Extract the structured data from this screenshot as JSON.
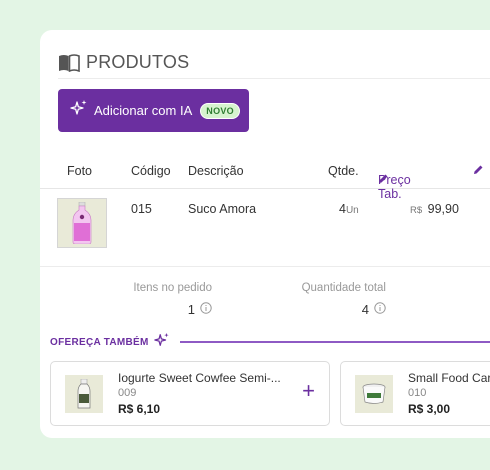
{
  "section": {
    "title": "PRODUTOS",
    "icon": "book-open-icon"
  },
  "ai_button": {
    "label": "Adicionar com IA",
    "badge": "NOVO",
    "icon": "sparkles-icon",
    "color": "#6b2fa0"
  },
  "table": {
    "headers": {
      "foto": "Foto",
      "codigo": "Código",
      "descricao": "Descrição",
      "qtde": "Qtde.",
      "preco": "Preço Tab."
    },
    "rows": [
      {
        "codigo": "015",
        "descricao": "Suco Amora",
        "qtde": "4",
        "unidade": "Un",
        "moeda": "R$",
        "preco": "99,90"
      }
    ]
  },
  "summary": {
    "itens_label": "Itens no pedido",
    "itens_value": "1",
    "quantidade_label": "Quantidade total",
    "quantidade_value": "4"
  },
  "offer": {
    "title": "OFEREÇA TAMBÉM",
    "products": [
      {
        "name": "Iogurte Sweet Cowfee Semi-...",
        "code": "009",
        "price": "R$ 6,10"
      },
      {
        "name": "Small Food Car",
        "code": "010",
        "price": "R$ 3,00"
      }
    ]
  },
  "colors": {
    "accent": "#6b2fa0",
    "background": "#e3f5e5",
    "badge_bg": "#d7f3cf"
  }
}
